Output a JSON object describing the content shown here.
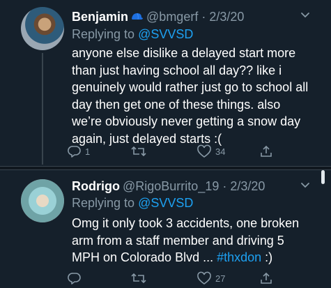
{
  "tweets": [
    {
      "name": "Benjamin",
      "badge_icon": "blue-cap-emoji",
      "handle": "@bmgerf · 2/3/20",
      "replying_prefix": "Replying to",
      "replying_to": "@SVVSD",
      "lines": [
        "anyone else dislike a delayed start more",
        "than just having school all day?? like i",
        "genuinely would rather just go to school all",
        "day then get one of these things. also",
        "we’re obviously never getting a snow day",
        "again, just delayed starts :("
      ],
      "reply_count": "1",
      "retweet_count": "",
      "like_count": "34"
    },
    {
      "name": "Rodrigo",
      "handle": "@RigoBurrito_19 · 2/3/20",
      "replying_prefix": "Replying to",
      "replying_to": "@SVVSD",
      "lines": [
        "Omg it only took 3 accidents, one broken",
        "arm from a staff member and driving 5"
      ],
      "line3_text": "MPH on Colorado Blvd ... ",
      "line3_hashtag": "#thxdon",
      "line3_tail": " :)",
      "reply_count": "",
      "retweet_count": "",
      "like_count": "27"
    }
  ],
  "colors": {
    "background": "#15202b",
    "secondary_text": "#8899a6",
    "link": "#1da1f2",
    "divider": "#38444d"
  }
}
